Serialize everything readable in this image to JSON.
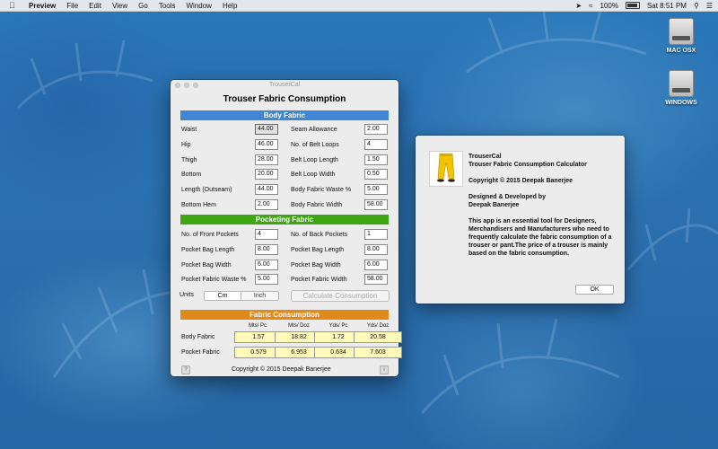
{
  "menubar": {
    "app": "Preview",
    "items": [
      "File",
      "Edit",
      "View",
      "Go",
      "Tools",
      "Window",
      "Help"
    ],
    "battery": "100%",
    "clock": "Sat 8:51 PM"
  },
  "desktop": {
    "icons": [
      {
        "label": "MAC OSX"
      },
      {
        "label": "WINDOWS"
      }
    ]
  },
  "window": {
    "title": "TrouserCal",
    "heading": "Trouser Fabric Consumption",
    "body_fabric": {
      "label": "Body Fabric",
      "left": [
        {
          "label": "Waist",
          "value": "44.00"
        },
        {
          "label": "Hip",
          "value": "46.00"
        },
        {
          "label": "Thigh",
          "value": "28.00"
        },
        {
          "label": "Bottom",
          "value": "20.00"
        },
        {
          "label": "Length (Outseam)",
          "value": "44.00"
        },
        {
          "label": "Bottom Hem",
          "value": "2.00"
        }
      ],
      "right": [
        {
          "label": "Seam Allowance",
          "value": "2.00"
        },
        {
          "label": "No. of Belt Loops",
          "value": "4"
        },
        {
          "label": "Belt Loop Length",
          "value": "1.50"
        },
        {
          "label": "Belt Loop Width",
          "value": "0.50"
        },
        {
          "label": "Body Fabric Waste %",
          "value": "5.00"
        },
        {
          "label": "Body Fabric Width",
          "value": "58.00"
        }
      ]
    },
    "pocketing_fabric": {
      "label": "Pocketing Fabric",
      "left": [
        {
          "label": "No. of Front Pockets",
          "value": "4"
        },
        {
          "label": "Pocket Bag Length",
          "value": "8.00"
        },
        {
          "label": "Pocket Bag Width",
          "value": "6.00"
        },
        {
          "label": "Pocket Fabric Waste %",
          "value": "5.00"
        }
      ],
      "right": [
        {
          "label": "No. of Back Pockets",
          "value": "1"
        },
        {
          "label": "Pocket Bag Length",
          "value": "8.00"
        },
        {
          "label": "Pocket Bag Width",
          "value": "6.00"
        },
        {
          "label": "Pocket Fabric Width",
          "value": "58.00"
        }
      ]
    },
    "units": {
      "label": "Units",
      "options": [
        "Cm",
        "Inch"
      ],
      "selected": "Cm"
    },
    "calculate_label": "Calculate Consumption",
    "consumption": {
      "label": "Fabric Consumption",
      "columns": [
        "Mts/ Pc",
        "Mts/ Doz",
        "Yds/ Pc",
        "Yds/ Doz"
      ],
      "rows": [
        {
          "label": "Body Fabric",
          "values": [
            "1.57",
            "18.82",
            "1.72",
            "20.58"
          ]
        },
        {
          "label": "Pocket Fabric",
          "values": [
            "0.579",
            "6.953",
            "0.634",
            "7.603"
          ]
        }
      ]
    },
    "footer": "Copyright © 2015  Deepak Banerjee",
    "help_glyph": "?",
    "info_glyph": "i"
  },
  "about": {
    "app_name": "TrouserCal",
    "subtitle": "Trouser Fabric Consumption Calculator",
    "copyright": "Copyright © 2015 Deepak Banerjee",
    "designed_line1": "Designed & Developed by",
    "designed_line2": "Deepak Banerjee",
    "description": "This app is an essential tool for Designers, Merchandisers and Manufacturers who need to frequently calculate the fabric consumption of a trouser or pant.The price of a trouser is mainly based on the fabric consumption.",
    "ok_label": "OK",
    "image_colors": {
      "pants": "#f2c400",
      "shoes": "#222222"
    }
  }
}
